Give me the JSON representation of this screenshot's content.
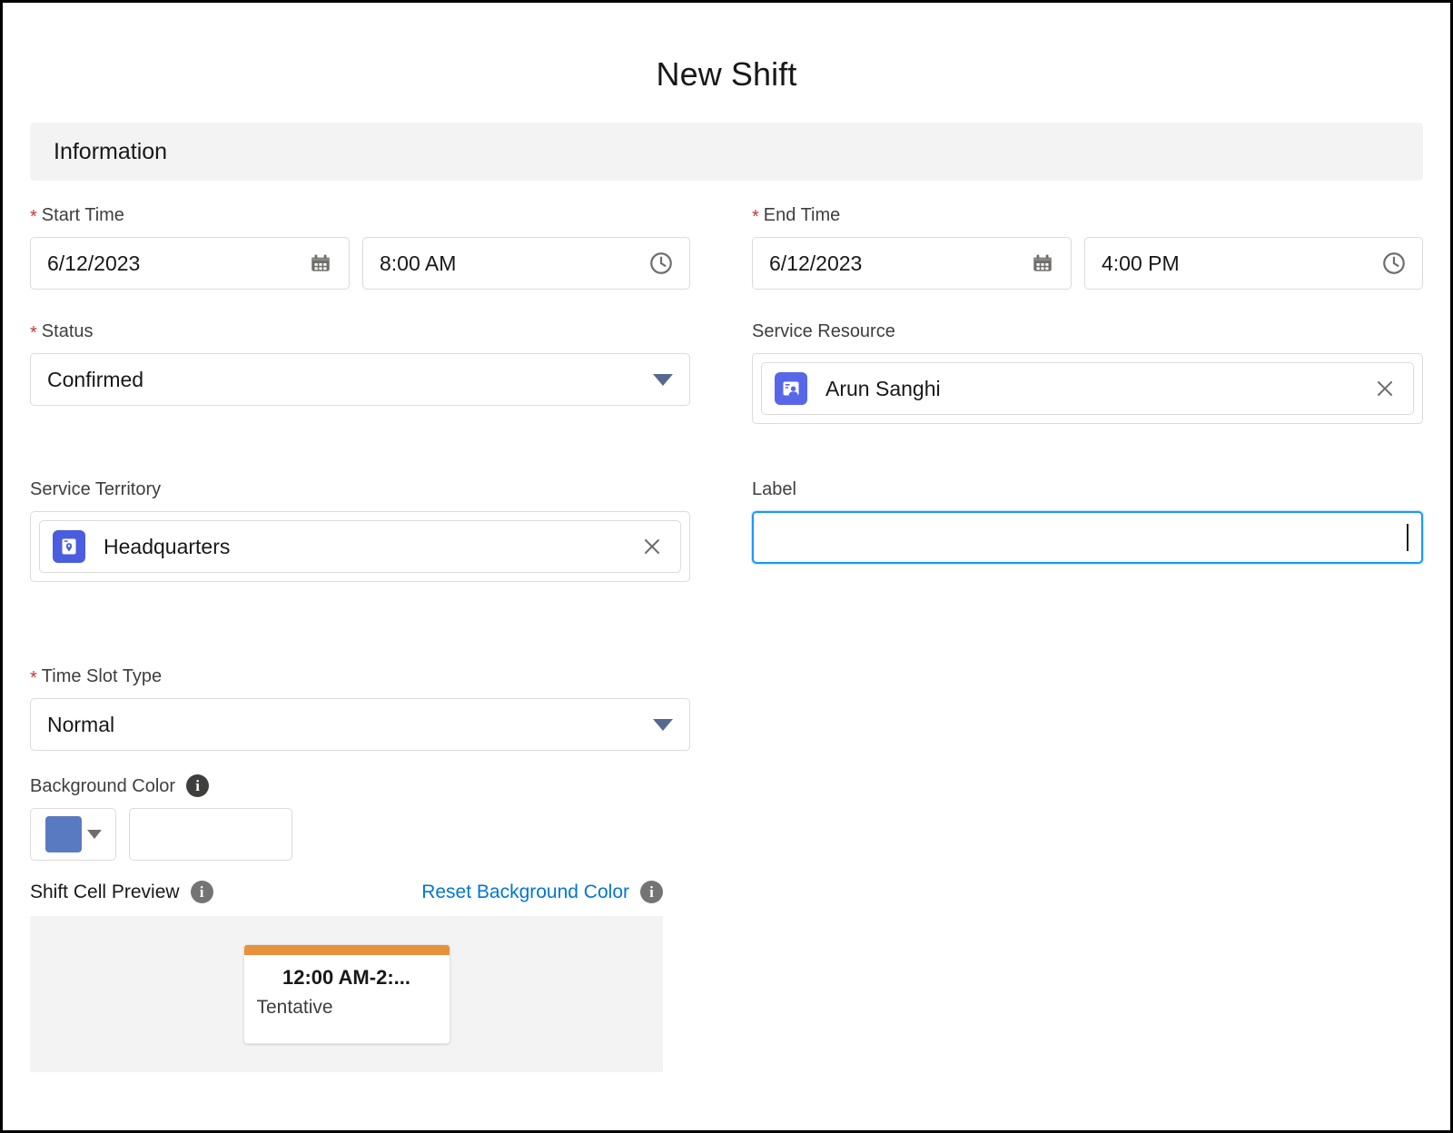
{
  "modal": {
    "title": "New Shift"
  },
  "section": {
    "title": "Information"
  },
  "fields": {
    "start_time": {
      "label": "Start Time",
      "required_marker": "*",
      "date_value": "6/12/2023",
      "time_value": "8:00 AM",
      "date_icon": "calendar-icon",
      "time_icon": "clock-icon"
    },
    "end_time": {
      "label": "End Time",
      "required_marker": "*",
      "date_value": "6/12/2023",
      "time_value": "4:00 PM",
      "date_icon": "calendar-icon",
      "time_icon": "clock-icon"
    },
    "status": {
      "label": "Status",
      "required_marker": "*",
      "value": "Confirmed",
      "icon": "chevron-down-icon"
    },
    "service_resource": {
      "label": "Service Resource",
      "value": "Arun Sanghi",
      "entity_icon": "service-resource-icon",
      "remove_icon": "close-icon"
    },
    "service_territory": {
      "label": "Service Territory",
      "value": "Headquarters",
      "entity_icon": "service-territory-icon",
      "remove_icon": "close-icon"
    },
    "label_field": {
      "label": "Label",
      "value": "",
      "placeholder": ""
    },
    "time_slot_type": {
      "label": "Time Slot Type",
      "required_marker": "*",
      "value": "Normal",
      "icon": "chevron-down-icon"
    },
    "background_color": {
      "label": "Background Color",
      "info_icon": "info-icon",
      "swatch_color": "#5a7ac0",
      "swatch_caret_icon": "chevron-down-icon",
      "hex_value": "",
      "hex_placeholder": ""
    }
  },
  "preview": {
    "title": "Shift Cell Preview",
    "title_info_icon": "info-icon",
    "reset_link": "Reset Background Color",
    "reset_info_icon": "info-icon",
    "card": {
      "accent_color": "#e8913c",
      "time_text": "12:00 AM-2:...",
      "status_text": "Tentative"
    }
  },
  "colors": {
    "required_star": "#c23934",
    "link": "#0176d3",
    "focus_border": "#1b96ff",
    "section_band": "#f3f3f3",
    "picklist_caret": "#54698d",
    "entity_icon_bg": "#5867e8"
  }
}
